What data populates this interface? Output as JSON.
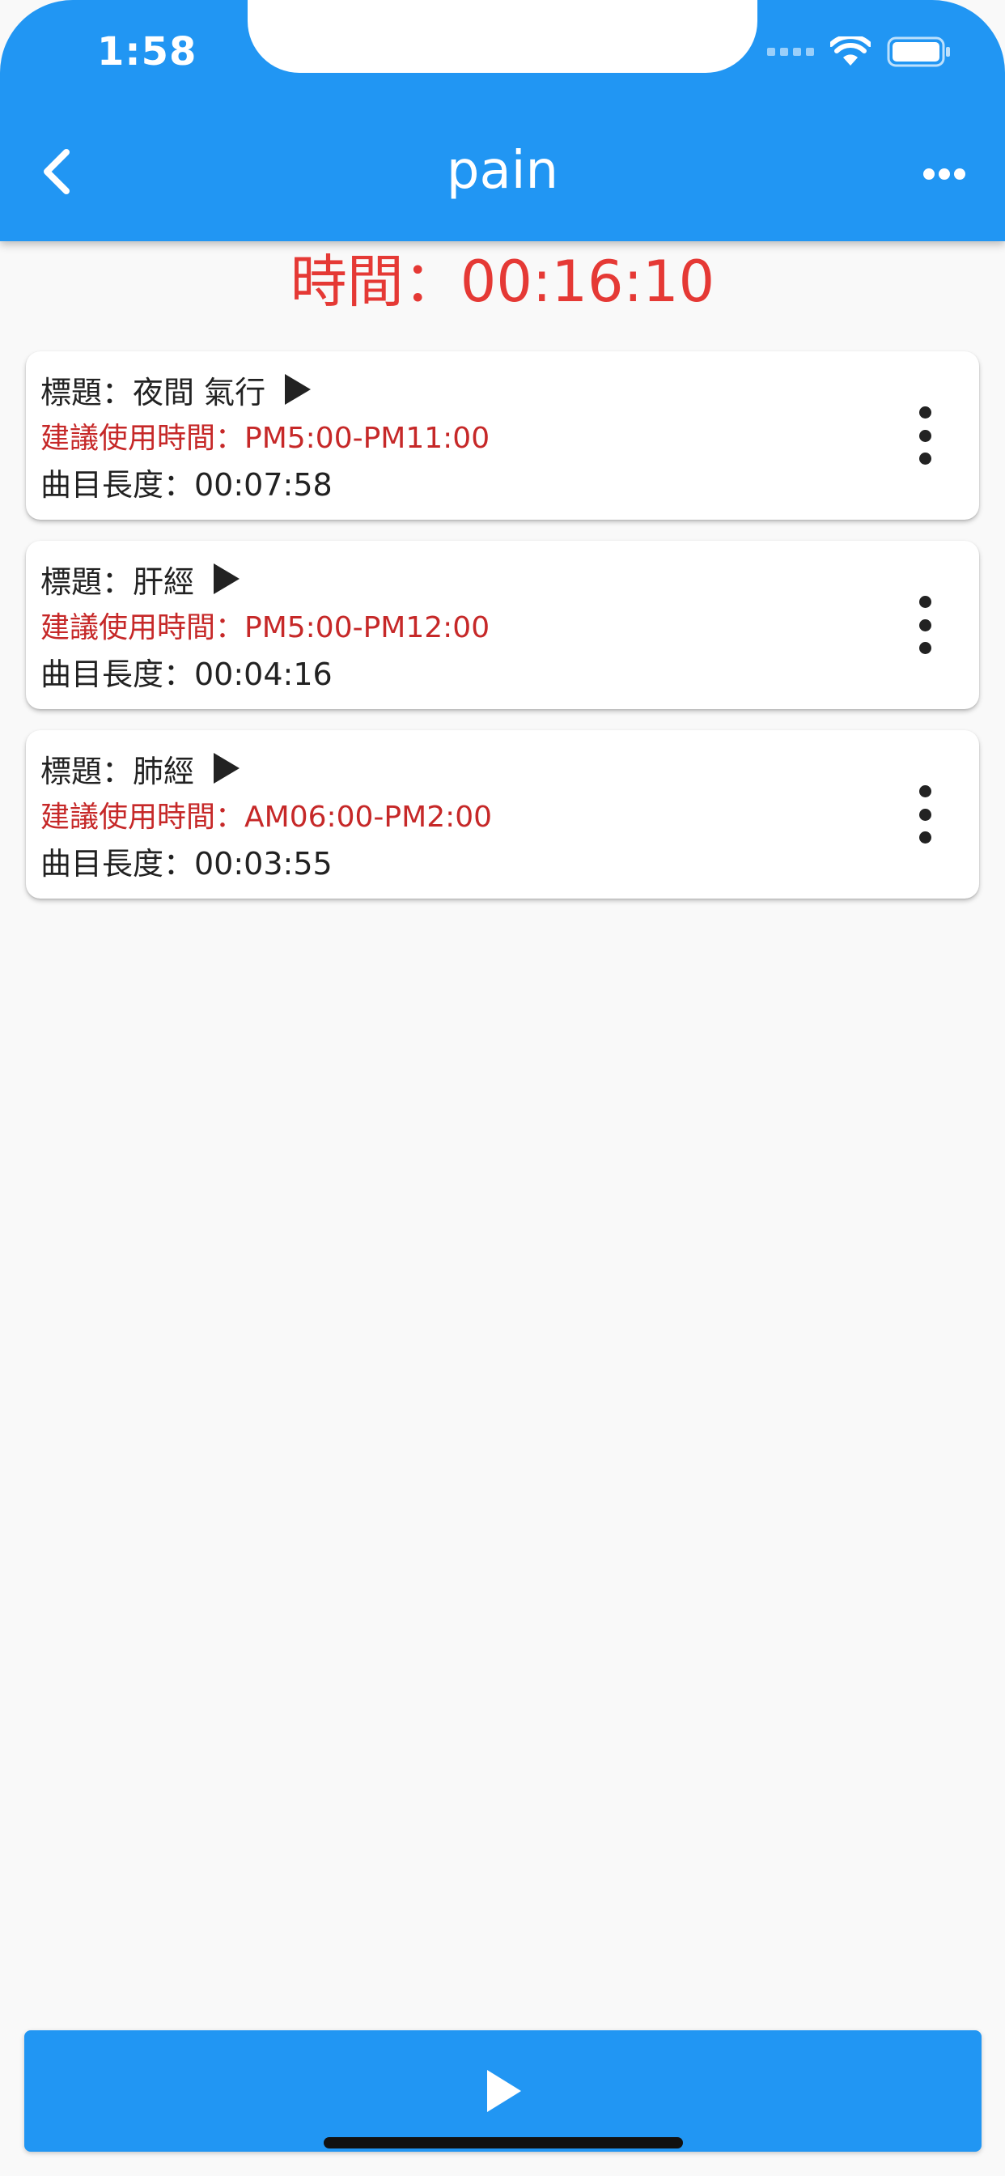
{
  "status_bar": {
    "time": "1:58"
  },
  "app_bar": {
    "title": "pain"
  },
  "timer": {
    "text": "時間：00:16:10"
  },
  "tracks": [
    {
      "title": "標題：夜間 氣行",
      "suggested": "建議使用時間：PM5:00-PM11:00",
      "length": "曲目長度：00:07:58"
    },
    {
      "title": "標題：肝經",
      "suggested": "建議使用時間：PM5:00-PM12:00",
      "length": "曲目長度：00:04:16"
    },
    {
      "title": "標題：肺經",
      "suggested": "建議使用時間：AM06:00-PM2:00",
      "length": "曲目長度：00:03:55"
    }
  ],
  "colors": {
    "primary": "#2196f3",
    "timer": "#e53935",
    "suggest": "#c62828",
    "text": "#222222",
    "background": "#f9f9f9"
  },
  "icons": {
    "back": "chevron-left-icon",
    "more": "more-horizontal-icon",
    "play": "play-icon",
    "card_menu": "more-vertical-icon",
    "wifi": "wifi-icon",
    "battery": "battery-icon"
  }
}
